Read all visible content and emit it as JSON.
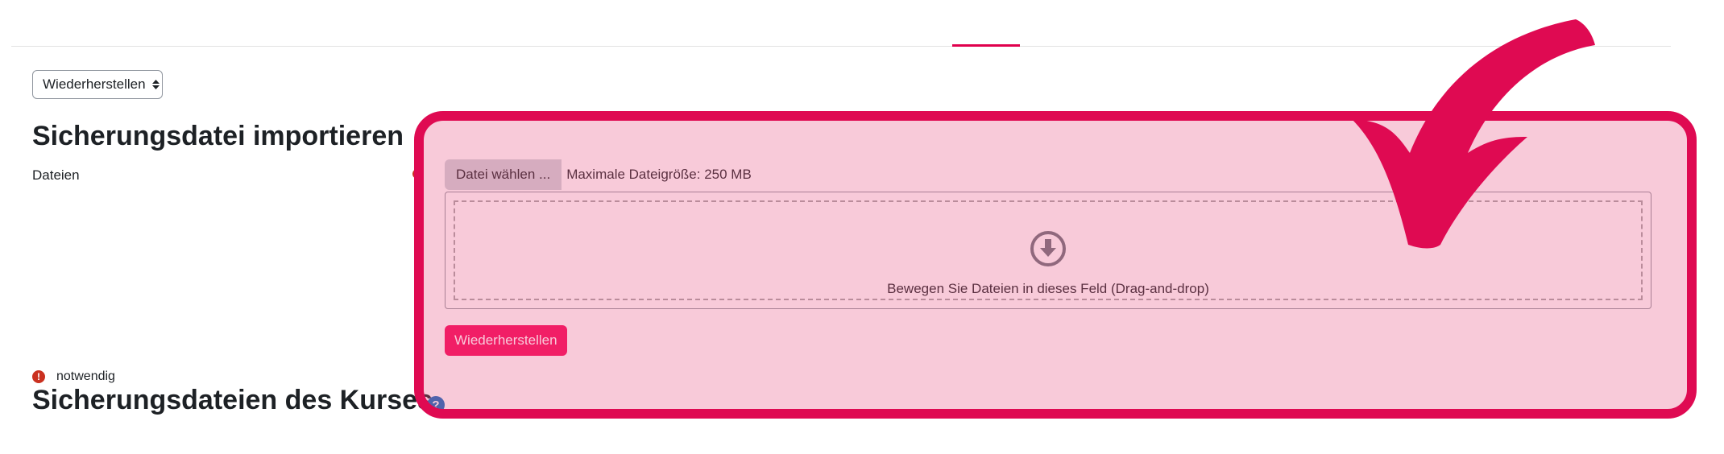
{
  "header": {
    "restore_select_value": "Wiederherstellen"
  },
  "import_section": {
    "title": "Sicherungsdatei importieren",
    "files_label": "Dateien",
    "choose_button_label": "Datei wählen ...",
    "max_size_text": "Maximale Dateigröße: 250 MB",
    "dropzone_text": "Bewegen Sie Dateien in dieses Feld (Drag-and-drop)",
    "restore_button_label": "Wiederherstellen",
    "required_text": "notwendig"
  },
  "course_backups_section": {
    "title": "Sicherungsdateien des Kurses"
  },
  "colors": {
    "accent": "#f50a5b",
    "highlight_border": "#df0a52",
    "required": "#ca3120",
    "help": "#0f6cbf"
  },
  "icons": {
    "select_caret": "sort-caret-icon",
    "dropzone": "download-arrow-icon",
    "required": "exclamation-icon",
    "help": "question-icon",
    "annotation": "curved-arrow-icon"
  }
}
